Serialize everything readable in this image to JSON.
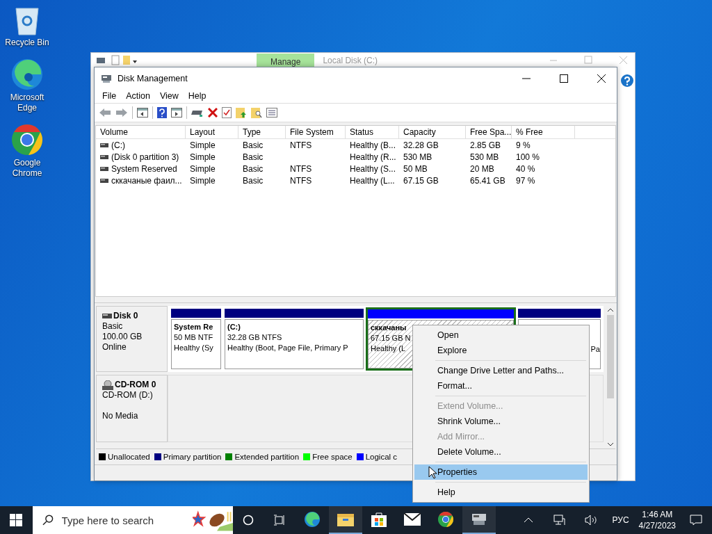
{
  "desktop_icons": [
    {
      "label": "Recycle Bin",
      "kind": "recycle"
    },
    {
      "label": "Microsoft Edge",
      "kind": "edge"
    },
    {
      "label": "Google Chrome",
      "kind": "chrome"
    }
  ],
  "back_window": {
    "ribbon_tab": "Manage",
    "title": "Local Disk (C:)"
  },
  "window": {
    "title": "Disk Management"
  },
  "menu": [
    "File",
    "Action",
    "View",
    "Help"
  ],
  "volumes": {
    "columns": [
      "Volume",
      "Layout",
      "Type",
      "File System",
      "Status",
      "Capacity",
      "Free Spa...",
      "% Free"
    ],
    "rows": [
      [
        "(C:)",
        "Simple",
        "Basic",
        "NTFS",
        "Healthy (B...",
        "32.28 GB",
        "2.85 GB",
        "9 %"
      ],
      [
        "(Disk 0 partition 3)",
        "Simple",
        "Basic",
        "",
        "Healthy (R...",
        "530 MB",
        "530 MB",
        "100 %"
      ],
      [
        "System Reserved",
        "Simple",
        "Basic",
        "NTFS",
        "Healthy (S...",
        "50 MB",
        "20 MB",
        "40 %"
      ],
      [
        "сккачаные фаил...",
        "Simple",
        "Basic",
        "NTFS",
        "Healthy (L...",
        "67.15 GB",
        "65.41 GB",
        "97 %"
      ]
    ]
  },
  "disks": [
    {
      "kind": "disk",
      "name": "Disk 0",
      "lines": [
        "Basic",
        "100.00 GB",
        "Online"
      ],
      "partitions": [
        {
          "title": "System Re",
          "lines": [
            "50 MB NTF",
            "Healthy (Sy"
          ],
          "color": "#000080",
          "selected": false
        },
        {
          "title": "(C:)",
          "lines": [
            "32.28 GB NTFS",
            "Healthy (Boot, Page File, Primary P"
          ],
          "color": "#000080",
          "selected": false
        },
        {
          "title": "сккачаны",
          "lines": [
            "67.15 GB N",
            "Healthy (L"
          ],
          "color": "#0000ff",
          "selected": true
        },
        {
          "lines": [
            "Pa"
          ],
          "color": "#000080",
          "selected": false
        }
      ]
    },
    {
      "kind": "cdrom",
      "name": "CD-ROM 0",
      "type": "CD-ROM (D:)",
      "status": "No Media"
    }
  ],
  "legend": [
    {
      "label": "Unallocated",
      "color": "#000000"
    },
    {
      "label": "Primary partition",
      "color": "#000080"
    },
    {
      "label": "Extended partition",
      "color": "#008000"
    },
    {
      "label": "Free space",
      "color": "#00ff00"
    },
    {
      "label": "Logical c",
      "color": "#0000ff"
    }
  ],
  "context_menu": [
    [
      {
        "label": "Open",
        "disabled": false,
        "selected": false
      },
      {
        "label": "Explore",
        "disabled": false,
        "selected": false
      }
    ],
    [
      {
        "label": "Change Drive Letter and Paths...",
        "disabled": false,
        "selected": false
      },
      {
        "label": "Format...",
        "disabled": false,
        "selected": false
      }
    ],
    [
      {
        "label": "Extend Volume...",
        "disabled": true,
        "selected": false
      },
      {
        "label": "Shrink Volume...",
        "disabled": false,
        "selected": false
      },
      {
        "label": "Add Mirror...",
        "disabled": true,
        "selected": false
      },
      {
        "label": "Delete Volume...",
        "disabled": false,
        "selected": false
      }
    ],
    [
      {
        "label": "Properties",
        "disabled": false,
        "selected": true
      }
    ],
    [
      {
        "label": "Help",
        "disabled": false,
        "selected": false
      }
    ]
  ],
  "taskbar": {
    "search": {
      "placeholder": "Type here to search"
    },
    "apps": [
      {
        "kind": "edge",
        "running": false
      },
      {
        "kind": "explorer",
        "running": true
      },
      {
        "kind": "store",
        "running": false
      },
      {
        "kind": "mail",
        "running": false
      },
      {
        "kind": "chrome",
        "running": false
      },
      {
        "kind": "diskmgmt",
        "running": true
      }
    ],
    "language": "РУС",
    "time": "1:46 AM",
    "date": "4/27/2023"
  }
}
